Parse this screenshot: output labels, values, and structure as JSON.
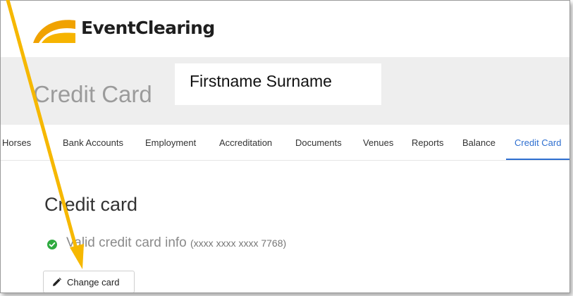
{
  "brand": {
    "name": "EventClearing",
    "logo_icon": "eventclearing-logo-icon"
  },
  "header": {
    "title": "Credit Card",
    "user_name": "Firstname Surname"
  },
  "tabs": [
    {
      "label": "Horses"
    },
    {
      "label": "Bank Accounts"
    },
    {
      "label": "Employment"
    },
    {
      "label": "Accreditation"
    },
    {
      "label": "Documents"
    },
    {
      "label": "Venues"
    },
    {
      "label": "Reports"
    },
    {
      "label": "Balance"
    },
    {
      "label": "Credit Card",
      "active": true
    }
  ],
  "main": {
    "heading": "Credit card",
    "status_text": "Valid credit card info",
    "card_masked": "(xxxx xxxx xxxx 7768)",
    "status_icon": "check-circle-icon",
    "change_button": {
      "label": "Change card",
      "icon": "pencil-icon"
    }
  },
  "colors": {
    "accent": "#2e6fd0",
    "status_ok": "#2eaa3f",
    "logo_orange": "#f0a200",
    "annotation_arrow": "#f6b800"
  }
}
